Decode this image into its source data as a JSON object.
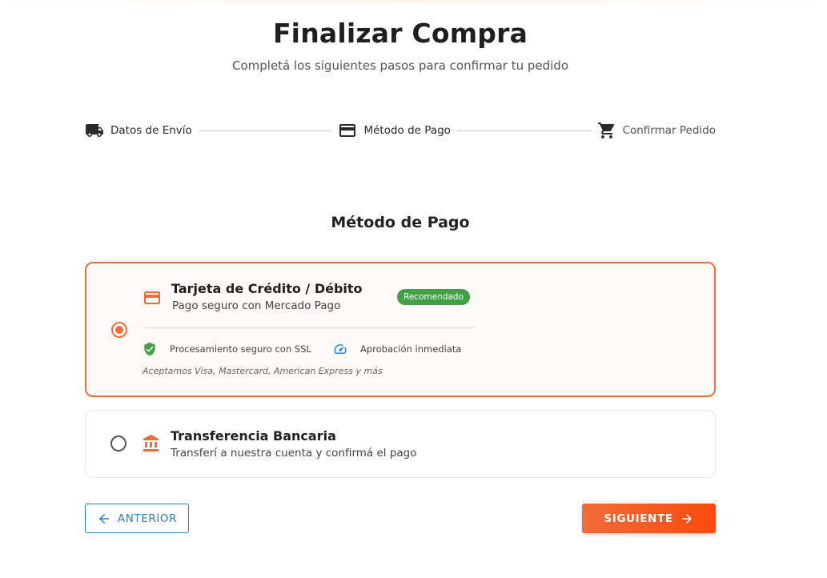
{
  "header": {
    "title": "Finalizar Compra",
    "subtitle": "Completá los siguientes pasos para confirmar tu pedido"
  },
  "stepper": {
    "steps": [
      {
        "label": "Datos de Envío",
        "icon": "truck-icon"
      },
      {
        "label": "Método de Pago",
        "icon": "credit-card-icon"
      },
      {
        "label": "Confirmar Pedido",
        "icon": "cart-icon"
      }
    ]
  },
  "section": {
    "title": "Método de Pago"
  },
  "options": {
    "card": {
      "title": "Tarjeta de Crédito / Débito",
      "subtitle": "Pago seguro con Mercado Pago",
      "badge": "Recomendado",
      "selected": true,
      "features": [
        {
          "label": "Procesamiento seguro con SSL",
          "icon": "shield-check-icon"
        },
        {
          "label": "Aprobación inmediata",
          "icon": "speedometer-icon"
        }
      ],
      "accepted": "Aceptamos Visa, Mastercard, American Express y más"
    },
    "transfer": {
      "title": "Transferencia Bancaria",
      "subtitle": "Transferí a nuestra cuenta y confirmá el pago",
      "selected": false
    }
  },
  "actions": {
    "prev_label": "ANTERIOR",
    "next_label": "SIGUIENTE"
  },
  "colors": {
    "accent": "#f26b3a",
    "badge": "#43a047",
    "link": "#2e7fb8",
    "security": "#43a047",
    "speed": "#1e88e5"
  }
}
